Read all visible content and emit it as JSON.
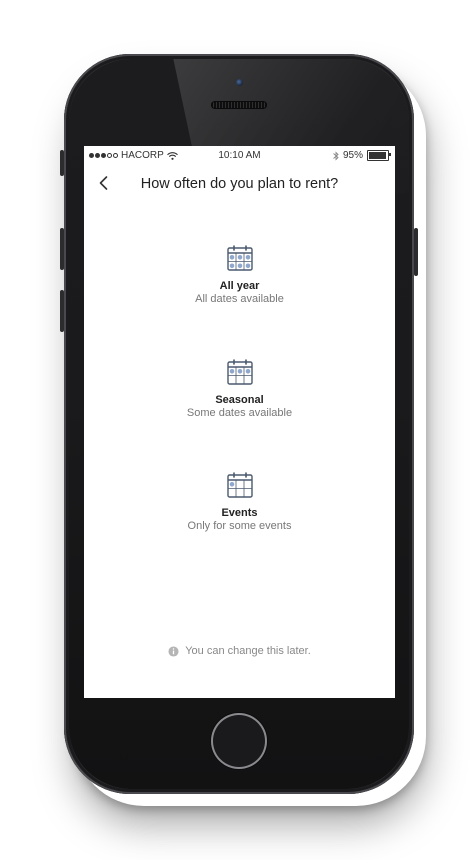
{
  "status_bar": {
    "carrier": "HACORP",
    "time": "10:10 AM",
    "battery": "95%",
    "battery_level": 0.95,
    "icons": [
      "signal-dots-icon",
      "wifi-icon",
      "bluetooth-icon",
      "battery-icon"
    ]
  },
  "header": {
    "back_icon": "chevron-left-icon",
    "title": "How often do you plan to rent?"
  },
  "options": [
    {
      "icon": "calendar-all-icon",
      "label": "All year",
      "sub": "All dates available"
    },
    {
      "icon": "calendar-seasonal-icon",
      "label": "Seasonal",
      "sub": "Some dates available"
    },
    {
      "icon": "calendar-events-icon",
      "label": "Events",
      "sub": "Only for some events"
    }
  ],
  "footer": {
    "icon": "info-icon",
    "note": "You can change this later."
  },
  "colors": {
    "icon_stroke": "#4a5a6e",
    "icon_fill": "#8fa7cc",
    "text_primary": "#222222",
    "text_secondary": "#777777"
  }
}
